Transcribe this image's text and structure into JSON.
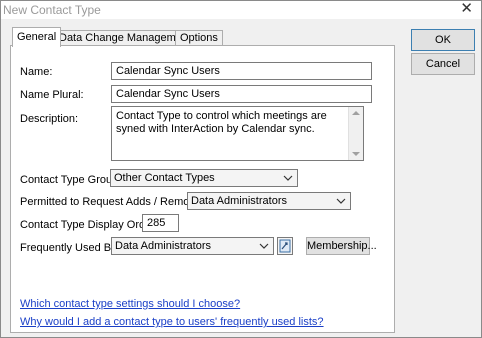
{
  "window": {
    "title": "New Contact Type"
  },
  "tabs": [
    {
      "label": "General"
    },
    {
      "label": "Data Change Management"
    },
    {
      "label": "Options"
    }
  ],
  "buttons": {
    "ok": "OK",
    "cancel": "Cancel",
    "membership": "Membership..."
  },
  "form": {
    "name_label": "Name:",
    "name_value": "Calendar Sync Users",
    "plural_label": "Name Plural:",
    "plural_value": "Calendar Sync Users",
    "description_label": "Description:",
    "description_value": "Contact Type to control which meetings are syned with InterAction by Calendar sync.",
    "group_label": "Contact Type Group:",
    "group_value": "Other Contact Types",
    "permitted_label": "Permitted to Request Adds / Removes:",
    "permitted_value": "Data Administrators",
    "order_label": "Contact Type Display Order:",
    "order_value": "285",
    "frequent_label": "Frequently Used By:",
    "frequent_value": "Data Administrators"
  },
  "links": {
    "settings": "Which contact type settings should I choose?",
    "frequent": "Why would I add a contact type to users' frequently used lists?"
  }
}
